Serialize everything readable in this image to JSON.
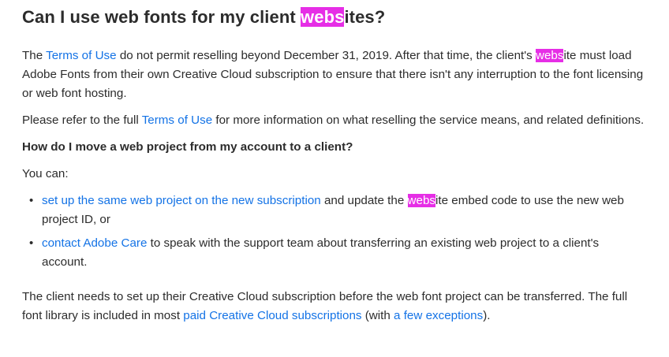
{
  "heading": {
    "before": "Can I use web fonts for my client ",
    "highlight": "webs",
    "after": "ites?"
  },
  "para1": {
    "t1": "The ",
    "link_terms": "Terms of Use",
    "t2": " do not permit reselling beyond December 31, 2019. After that time, the client's ",
    "highlight": "webs",
    "t3": "ite must load Adobe Fonts from their own Creative Cloud subscription to ensure that there isn't any interruption to the font licensing or web font hosting."
  },
  "para2": {
    "t1": "Please refer to the full ",
    "link_terms": "Terms of Use",
    "t2": " for more information on what reselling the service means, and related definitions."
  },
  "subheading": "How do I move a web project from my account to a client?",
  "you_can": "You can:",
  "list": {
    "item1": {
      "link": "set up the same web project on the new subscription",
      "t1": " and update the ",
      "highlight": "webs",
      "t2": "ite embed code to use the new web project ID, or"
    },
    "item2": {
      "link": "contact Adobe Care",
      "t1": " to speak with the support team about transferring an existing web project to a client's account."
    }
  },
  "para3": {
    "t1": "The client needs to set up their Creative Cloud subscription before the web font project can be transferred. The full font library is included in most ",
    "link_plans": "paid Creative Cloud subscriptions",
    "t2": " (with ",
    "link_exceptions": "a few exceptions",
    "t3": ")."
  },
  "colors": {
    "link": "#1473e6",
    "highlight_bg": "#e62ee6",
    "text": "#2c2c2c"
  }
}
